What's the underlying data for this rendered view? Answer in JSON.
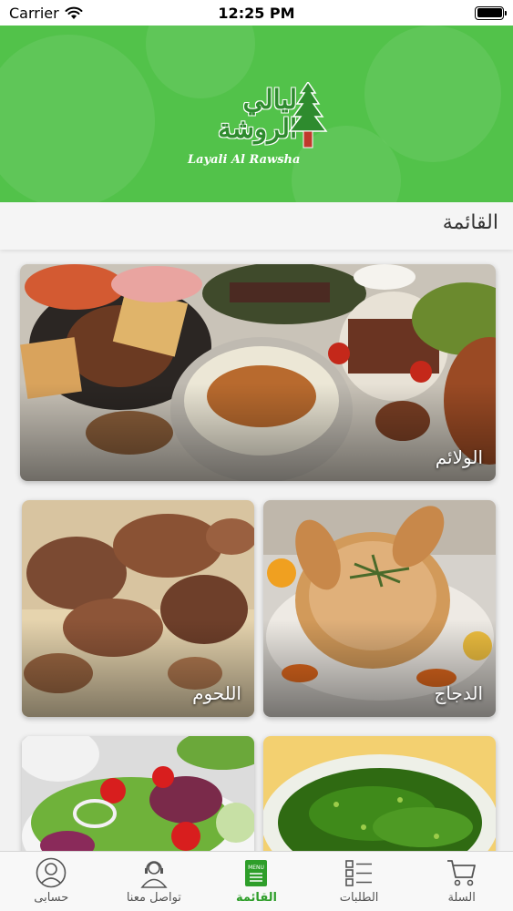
{
  "status": {
    "carrier": "Carrier",
    "time": "12:25 PM"
  },
  "brand": {
    "arabic": "ليالي الروشة",
    "latin": "Layali Al Rawsha"
  },
  "page": {
    "title": "القائمة"
  },
  "categories": [
    {
      "label": "الولائم"
    },
    {
      "label": "الدجاج"
    },
    {
      "label": "اللحوم"
    },
    {
      "label": ""
    },
    {
      "label": ""
    }
  ],
  "tabs": [
    {
      "label": "حسابى",
      "icon": "account-icon"
    },
    {
      "label": "تواصل معنا",
      "icon": "support-icon"
    },
    {
      "label": "القائمة",
      "icon": "menu-icon",
      "badge": "MENU"
    },
    {
      "label": "الطلبات",
      "icon": "orders-icon"
    },
    {
      "label": "السلة",
      "icon": "cart-icon"
    }
  ],
  "colors": {
    "brand_green": "#52c24a",
    "active_tab": "#2e9e2a"
  }
}
